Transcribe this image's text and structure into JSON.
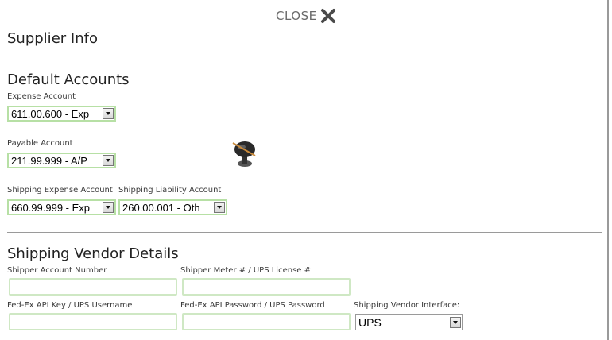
{
  "close": {
    "label": "CLOSE"
  },
  "supplier_info": {
    "title": "Supplier Info"
  },
  "default_accounts": {
    "title": "Default Accounts",
    "expense": {
      "label": "Expense Account",
      "value": "611.00.600 - Exp"
    },
    "payable": {
      "label": "Payable Account",
      "value": "211.99.999 - A/P"
    },
    "shipping_expense": {
      "label": "Shipping Expense Account",
      "value": "660.99.999 - Exp"
    },
    "shipping_liability": {
      "label": "Shipping Liability Account",
      "value": "260.00.001 - Oth"
    }
  },
  "shipping_vendor": {
    "title": "Shipping Vendor Details",
    "shipper_account": {
      "label": "Shipper Account Number",
      "value": ""
    },
    "meter_license": {
      "label": "Shipper Meter # / UPS License #",
      "value": ""
    },
    "api_key": {
      "label": "Fed-Ex API Key / UPS Username",
      "value": ""
    },
    "api_password": {
      "label": "Fed-Ex API Password / UPS Password",
      "value": ""
    },
    "interface": {
      "label": "Shipping Vendor Interface:",
      "value": "UPS"
    }
  },
  "colors": {
    "field_border": "#b7e0a5",
    "divider": "#9a9a9a"
  },
  "icons": {
    "close": "close-x-icon",
    "busy": "busy-cursor-icon"
  }
}
